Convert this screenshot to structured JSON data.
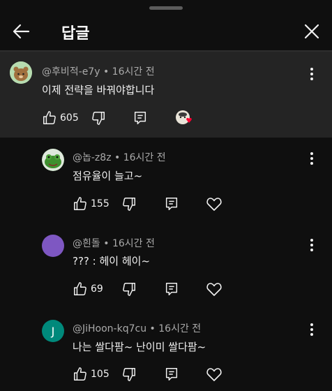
{
  "header": {
    "title": "답글",
    "back_icon": "arrow-left-icon",
    "close_icon": "close-icon"
  },
  "parent": {
    "author": "@후비적-e7y",
    "time": "16시간 전",
    "text": "이제 전략을 바꿔야합니다",
    "likes": "605",
    "creator_heart": true
  },
  "replies": [
    {
      "author": "@놉-z8z",
      "time": "16시간 전",
      "text": "점유율이 늘고~",
      "likes": "155",
      "avatar_color": "#2d7a2d"
    },
    {
      "author": "@흰돌",
      "time": "16시간 전",
      "text": "??? : 헤이 헤이~",
      "likes": "69",
      "avatar_color": "#7e57c2"
    },
    {
      "author": "@JiHoon-kq7cu",
      "time": "16시간 전",
      "text": "나는 쌀다팜~ 난이미 쌀다팜~",
      "likes": "105",
      "avatar_color": "#00897b",
      "avatar_letter": "J"
    }
  ],
  "colors": {
    "background": "#0f0f0f",
    "highlight": "#242424",
    "meta_text": "#aaaaaa",
    "heart": "#ff0033"
  }
}
